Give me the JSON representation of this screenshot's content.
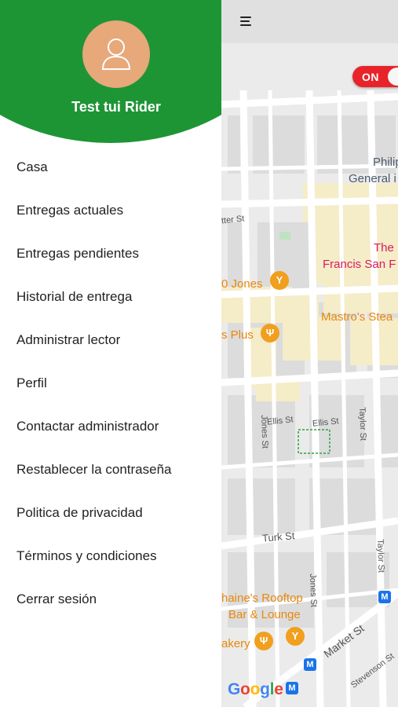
{
  "drawer": {
    "user_name": "Test tui Rider",
    "menu": [
      {
        "label": "Casa"
      },
      {
        "label": "Entregas actuales"
      },
      {
        "label": "Entregas pendientes"
      },
      {
        "label": "Historial de entrega"
      },
      {
        "label": "Administrar lector"
      },
      {
        "label": "Perfil"
      },
      {
        "label": "Contactar administrador"
      },
      {
        "label": "Restablecer la contraseña"
      },
      {
        "label": "Politica de privacidad"
      },
      {
        "label": "Términos y condiciones"
      },
      {
        "label": "Cerrar sesión"
      }
    ]
  },
  "toggle": {
    "label": "ON"
  },
  "map": {
    "streets": {
      "sutter": "tter St",
      "jones": "Jones St",
      "ellis_left": "Ellis St",
      "ellis_right": "Ellis St",
      "taylor_top": "Taylor St",
      "taylor_bottom": "Taylor St",
      "turk": "Turk St",
      "jones_bottom": "Jones St",
      "market": "Market St",
      "stevenson": "Stevenson St"
    },
    "pois": {
      "philip": "Philip",
      "general": "General i",
      "the": "The",
      "francis": "Francis San F",
      "jones_bar": "0 Jones",
      "mastros": "Mastro's Stea",
      "plus": "s Plus",
      "rooftop1": "haine's Rooftop",
      "rooftop2": "Bar & Lounge",
      "bakery": "akery"
    },
    "google": {
      "g1": "G",
      "o1": "o",
      "o2": "o",
      "g2": "g",
      "l": "l",
      "e": "e"
    }
  }
}
